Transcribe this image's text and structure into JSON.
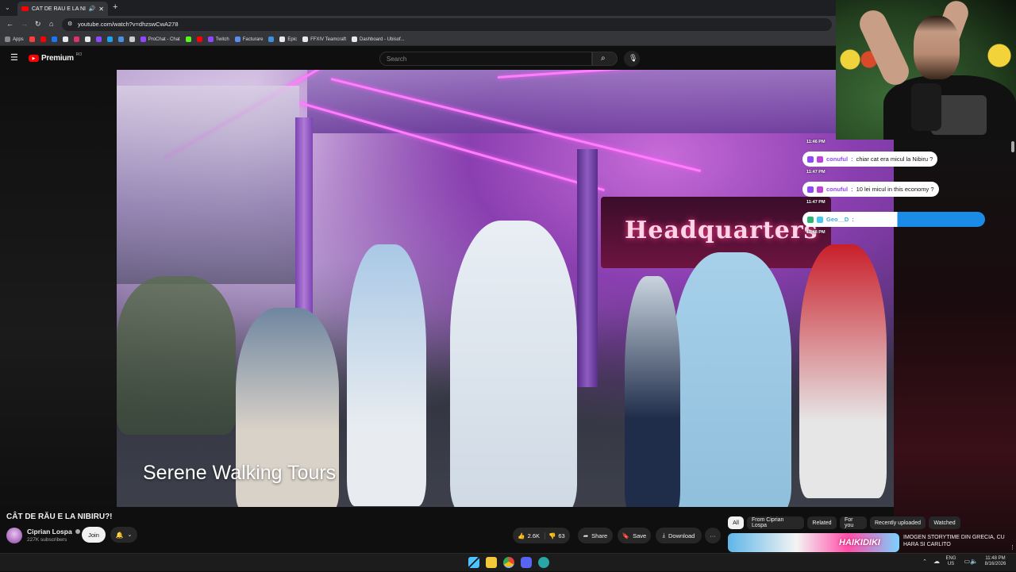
{
  "browser": {
    "tab_title": "CÂT DE RĂU E LA NIBIRU!!",
    "url": "youtube.com/watch?v=dhzswCwA278",
    "bookmarks": [
      {
        "label": "Apps",
        "color": "#888888"
      },
      {
        "label": "",
        "color": "#ff3d3d"
      },
      {
        "label": "",
        "color": "#ff0000"
      },
      {
        "label": "",
        "color": "#1877f2"
      },
      {
        "label": "",
        "color": "#e8e8e8"
      },
      {
        "label": "",
        "color": "#e1306c"
      },
      {
        "label": "",
        "color": "#e8e8e8"
      },
      {
        "label": "",
        "color": "#9147ff"
      },
      {
        "label": "",
        "color": "#1da1f2"
      },
      {
        "label": "",
        "color": "#4a90e2"
      },
      {
        "label": "",
        "color": "#cccccc"
      },
      {
        "label": "ProChat - Chat",
        "color": "#9147ff"
      },
      {
        "label": "",
        "color": "#53fc18"
      },
      {
        "label": "",
        "color": "#ff0000"
      },
      {
        "label": "Twitch",
        "color": "#9147ff"
      },
      {
        "label": "Facturare",
        "color": "#5a8dee"
      },
      {
        "label": "",
        "color": "#3f8fe0"
      },
      {
        "label": "Epic",
        "color": "#e8e8e8"
      },
      {
        "label": "FFXIV Teamcraft",
        "color": "#e8e8e8"
      },
      {
        "label": "Dashboard - Ubisof...",
        "color": "#e8e8e8"
      }
    ]
  },
  "youtube": {
    "logo_text": "Premium",
    "logo_sup": "RO",
    "search_placeholder": "Search"
  },
  "video": {
    "overlay_text": "Serene Walking Tours",
    "sign_text": "Headquarters"
  },
  "meta": {
    "title": "CÂT DE RĂU E LA NIBIRU?!",
    "channel_name": "Ciprian Lospa",
    "subscribers": "227K subscribers",
    "join_label": "Join",
    "likes": "2.6K",
    "dislikes": "63",
    "share_label": "Share",
    "save_label": "Save",
    "download_label": "Download",
    "more_label": "···"
  },
  "chips": [
    "All",
    "From Ciprian Lospa",
    "Related",
    "For you",
    "Recently uploaded",
    "Watched"
  ],
  "recommended": {
    "title": "IMOGEN STORYTIME DIN GRECIA, CU HARA SI CARLITO",
    "thumb_text": "HAIKIDIKI"
  },
  "chat": {
    "messages": [
      {
        "time": "11:46 PM",
        "user": "conuful",
        "text": "chiar cat era micul la Nibiru ?"
      },
      {
        "time": "11:47 PM",
        "user": "conuful",
        "text": "10 lei micul in this economy ?"
      },
      {
        "time": "11:47 PM",
        "user": "Geo__D",
        "text": ""
      },
      {
        "time": "11:48 PM",
        "user": "",
        "text": ""
      }
    ],
    "accent": "#9147ff",
    "highlight_color": "#1b8be8"
  },
  "taskbar": {
    "lang_top": "ENG",
    "lang_bottom": "US",
    "time": "11:48 PM",
    "date": "8/16/2026"
  }
}
